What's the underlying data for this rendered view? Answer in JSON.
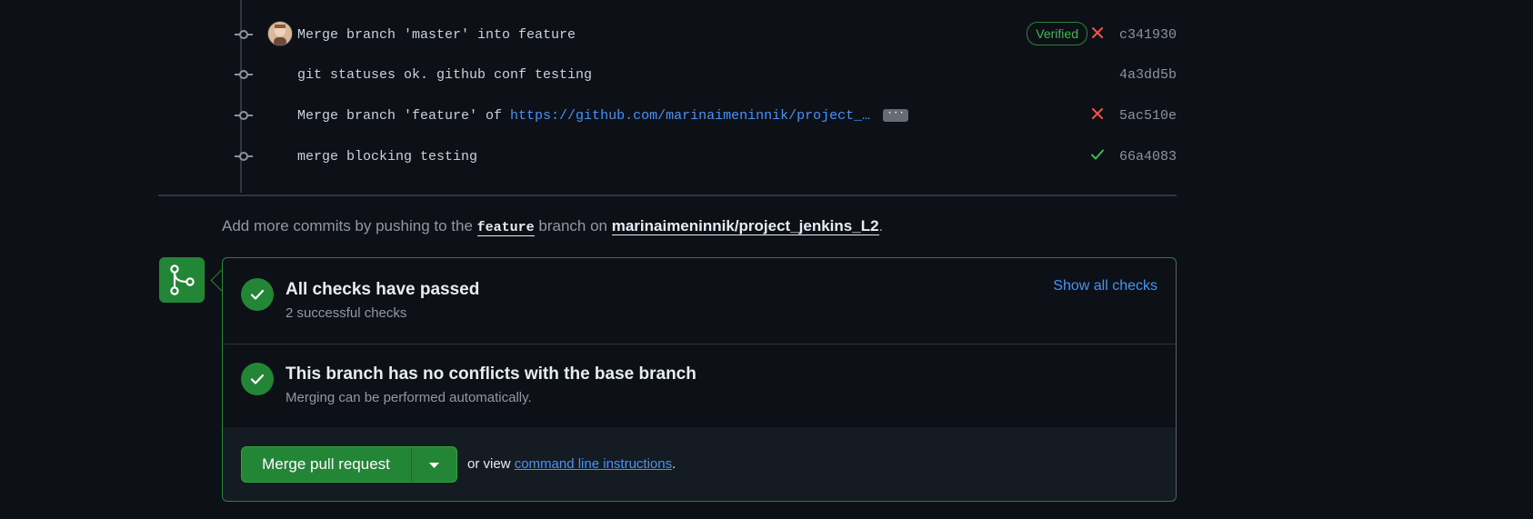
{
  "commits": [
    {
      "message": "Merge branch 'master' into feature",
      "verified": "Verified",
      "status": "failure",
      "sha": "c341930",
      "has_avatar": true
    },
    {
      "message": "git statuses ok. github conf testing",
      "status": "none",
      "sha": "4a3dd5b",
      "has_avatar": false
    },
    {
      "message_prefix": "Merge branch 'feature' of ",
      "link_text": "https://github.com/marinaimeninnik/project_…",
      "ellipsis": "···",
      "status": "failure",
      "sha": "5ac510e",
      "has_avatar": false
    },
    {
      "message": "merge blocking testing",
      "status": "success",
      "sha": "66a4083",
      "has_avatar": false
    }
  ],
  "hint": {
    "prefix": "Add more commits by pushing to the ",
    "branch": "feature",
    "middle": " branch on ",
    "repo": "marinaimeninnik/project_jenkins_L2",
    "suffix": "."
  },
  "checks": {
    "title": "All checks have passed",
    "subtitle": "2 successful checks",
    "show_all": "Show all checks"
  },
  "conflicts": {
    "title": "This branch has no conflicts with the base branch",
    "subtitle": "Merging can be performed automatically."
  },
  "merge": {
    "button_label": "Merge pull request",
    "or_view": "or view ",
    "cli_link": "command line instructions",
    "trailing": "."
  },
  "colors": {
    "success": "#238636",
    "failure": "#f85149",
    "link": "#4493f8",
    "background": "#0d1117"
  }
}
